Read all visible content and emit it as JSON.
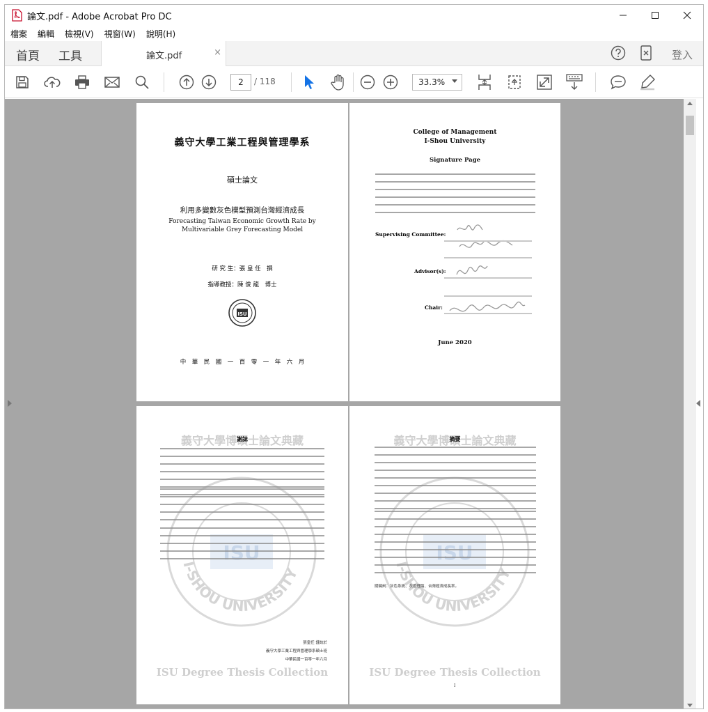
{
  "window": {
    "title": "論文.pdf - Adobe Acrobat Pro DC",
    "min": "—",
    "max": "☐",
    "close": "✕"
  },
  "menu": [
    "檔案",
    "編輯",
    "檢視(V)",
    "視窗(W)",
    "說明(H)"
  ],
  "tabs": {
    "home": "首頁",
    "tools": "工具",
    "doc": "論文.pdf",
    "doc_close": "×",
    "signin": "登入"
  },
  "toolbar": {
    "page_current": "2",
    "page_total": "/ 118",
    "zoom": "33.3%"
  },
  "page1": {
    "university": "義守大學工業工程與管理學系",
    "degree": "碩士論文",
    "title_zh": "利用多變數灰色模型預測台灣經濟成長",
    "title_en1": "Forecasting Taiwan Economic Growth Rate by",
    "title_en2": "Multivariable Grey Forecasting Model",
    "student": "研 究 生：張 皇 任　撰",
    "advisor": "指導教授：陳 俊 龍　博士",
    "date": "中　華　民　國　一　百　零　一　年　六　月"
  },
  "page2": {
    "college": "College of Management",
    "university": "I-Shou University",
    "heading": "Signature Page",
    "supervising": "Supervising Committee:",
    "advisors": "Advisor(s):",
    "chair": "Chair:",
    "date": "June 2020"
  },
  "page3": {
    "heading": "謝誌",
    "watermark_top": "義守大學博碩士論文典藏",
    "watermark_bottom": "ISU Degree Thesis Collection",
    "sign1": "張皇任 謹誌於",
    "sign2": "義守大學工業工程與管理學系碩士班",
    "sign3": "中華民國一百零一年六月"
  },
  "page4": {
    "heading": "摘要",
    "watermark_top": "義守大學博碩士論文典藏",
    "watermark_bottom": "ISU Degree Thesis Collection",
    "keywords": "關鍵詞：灰色系統、灰色理論、台灣經濟成長率。",
    "page_num": "I"
  },
  "seal": {
    "text": "I-SHOU UNIVERSITY",
    "abbr": "ISU"
  }
}
